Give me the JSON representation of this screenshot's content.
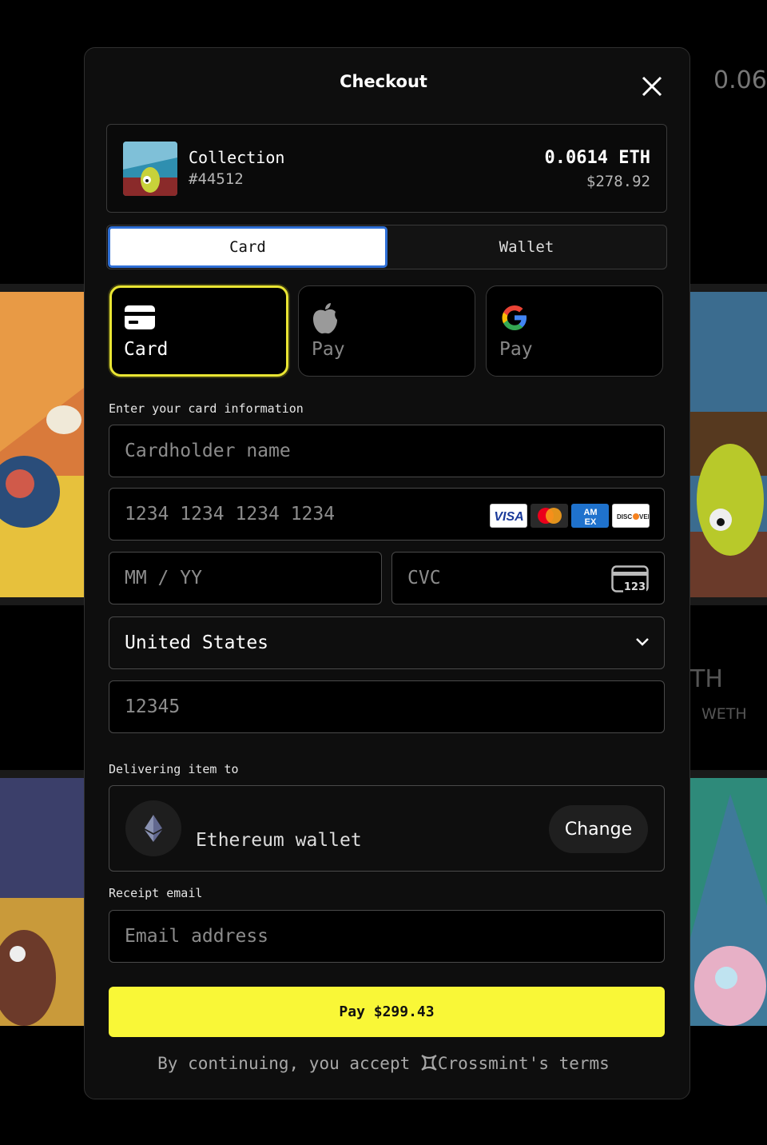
{
  "background": {
    "price_top": "0.06",
    "price_mid": "TH",
    "price_mid_sub": "WETH"
  },
  "modal": {
    "title": "Checkout",
    "item": {
      "collection": "Collection",
      "token_id": "#44512",
      "price_eth": "0.0614 ETH",
      "price_usd": "$278.92"
    },
    "tabs": {
      "card": "Card",
      "wallet": "Wallet"
    },
    "payment_methods": {
      "card": "Card",
      "apple_pay": "Pay",
      "google_pay": "Pay"
    },
    "card_section_label": "Enter your card information",
    "fields": {
      "cardholder_placeholder": "Cardholder name",
      "card_number_placeholder": "1234 1234 1234 1234",
      "expiry_placeholder": "MM / YY",
      "cvc_placeholder": "CVC",
      "country": "United States",
      "postal_code_placeholder": "12345"
    },
    "card_brands": [
      "VISA",
      "Mastercard",
      "AMEX",
      "DISCOVER"
    ],
    "cvc_icon_text": "123",
    "delivery": {
      "label": "Delivering item to",
      "wallet": "Ethereum wallet",
      "change": "Change"
    },
    "receipt": {
      "label": "Receipt email",
      "placeholder": "Email address"
    },
    "pay_button": "Pay $299.43",
    "terms": {
      "prefix": "By continuing, you accept",
      "link": "Crossmint's terms"
    }
  },
  "colors": {
    "accent_yellow": "#f9f737",
    "selected_border": "#e9e533",
    "tab_focus_blue": "#2f6fd6"
  }
}
